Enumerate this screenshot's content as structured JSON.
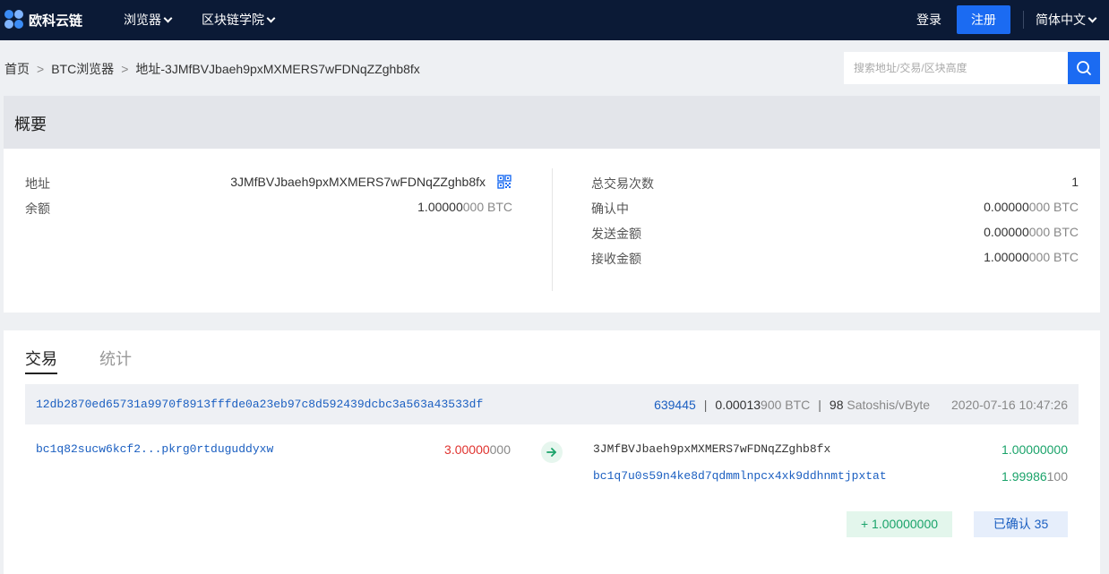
{
  "header": {
    "logo_text": "欧科云链",
    "nav": [
      {
        "label": "浏览器"
      },
      {
        "label": "区块链学院"
      }
    ],
    "login": "登录",
    "register": "注册",
    "language": "简体中文"
  },
  "breadcrumb": {
    "home": "首页",
    "explorer": "BTC浏览器",
    "current": "地址-3JMfBVJbaeh9pxMXMERS7wFDNqZZghb8fx",
    "separator": ">"
  },
  "search": {
    "placeholder": "搜索地址/交易/区块高度"
  },
  "overview": {
    "title": "概要",
    "address_label": "地址",
    "address_value": "3JMfBVJbaeh9pxMXMERS7wFDNqZZghb8fx",
    "balance_label": "余额",
    "balance_main": "1.00000",
    "balance_rest": "000 BTC",
    "tx_count_label": "总交易次数",
    "tx_count_value": "1",
    "confirming_label": "确认中",
    "confirming_main": "0.00000",
    "confirming_rest": "000 BTC",
    "sent_label": "发送金额",
    "sent_main": "0.00000",
    "sent_rest": "000 BTC",
    "received_label": "接收金额",
    "received_main": "1.00000",
    "received_rest": "000 BTC"
  },
  "tabs": {
    "transactions": "交易",
    "stats": "统计"
  },
  "transaction": {
    "hash": "12db2870ed65731a9970f8913fffde0a23eb97c8d592439dcbc3a563a43533df",
    "block": "639445",
    "fee_main": "0.00013",
    "fee_rest": "900 BTC",
    "fee_rate_value": "98",
    "fee_rate_unit": "Satoshis/vByte",
    "separator": "|",
    "time": "2020-07-16 10:47:26",
    "input": {
      "address": "bc1q82sucw6kcf2...pkrg0rtduguddyxw",
      "amount_main": "3.00000",
      "amount_rest": "000"
    },
    "outputs": [
      {
        "address": "3JMfBVJbaeh9pxMXMERS7wFDNqZZghb8fx",
        "amount_main": "1.00000000",
        "amount_rest": ""
      },
      {
        "address": "bc1q7u0s59n4ke8d7qdmmlnpcx4xk9ddhnmtjpxtat",
        "amount_main": "1.99986",
        "amount_rest": "100"
      }
    ],
    "net_change": "+ 1.00000000",
    "confirmations": "已确认 35"
  },
  "colors": {
    "topbar": "#0b1a36",
    "brand_blue": "#1b6bf2",
    "link_blue": "#1b5fc1",
    "input_red": "#e0332f",
    "output_green": "#1aa36a"
  },
  "icons": [
    "logo-icon",
    "chevron-down-icon",
    "search-icon",
    "qr-code-icon",
    "arrow-right-icon"
  ]
}
